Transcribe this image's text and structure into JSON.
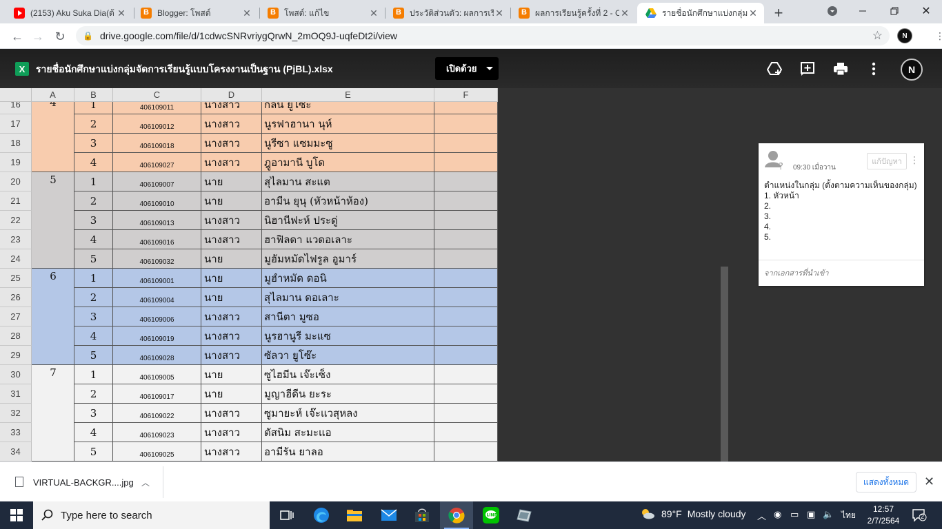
{
  "browser": {
    "tabs": [
      {
        "title": "(2153) Aku Suka Dia(ต้",
        "icon": "youtube-icon",
        "active": false
      },
      {
        "title": "Blogger: โพสต์",
        "icon": "blogger-icon",
        "active": false
      },
      {
        "title": "โพสต์: แก้ไข",
        "icon": "blogger-icon",
        "active": false
      },
      {
        "title": "ประวัติส่วนตัว: ผลการเรียนรู้",
        "icon": "blogger-icon",
        "active": false
      },
      {
        "title": "ผลการเรียนรู้ครั้งที่ 2 - CC",
        "icon": "blogger-icon",
        "active": false
      },
      {
        "title": "รายชื่อนักศึกษาแบ่งกลุ่มจัด",
        "icon": "google-drive-icon",
        "active": true
      }
    ],
    "new_tab": "+",
    "url": "drive.google.com/file/d/1cdwcSNRvriygQrwN_2mOQ9J-uqfeDt2i/view",
    "profile_initial": "N"
  },
  "viewer": {
    "file_icon": "X",
    "file_title": "รายชื่อนักศึกษาแบ่งกลุ่มจัดการเรียนรู้แบบโครงงานเป็นฐาน (PjBL).xlsx",
    "open_with_label": "เปิดด้วย",
    "profile_initial": "N"
  },
  "sheet": {
    "columns": [
      "A",
      "B",
      "C",
      "D",
      "E",
      "F"
    ],
    "groups": [
      {
        "number": "4",
        "color": "#f8ccae",
        "rows": [
          {
            "row": "16",
            "b": "1",
            "c": "406109011",
            "d": "นางสาว",
            "e": "กลีน ยูโซะ"
          },
          {
            "row": "17",
            "b": "2",
            "c": "406109012",
            "d": "นางสาว",
            "e": "นูรฟาฮานา นุห์"
          },
          {
            "row": "18",
            "b": "3",
            "c": "406109018",
            "d": "นางสาว",
            "e": "นูรีซา แซมมะซู"
          },
          {
            "row": "19",
            "b": "4",
            "c": "406109027",
            "d": "นางสาว",
            "e": "ฎูอามานี บูโด"
          }
        ]
      },
      {
        "number": "5",
        "color": "#d0cece",
        "rows": [
          {
            "row": "20",
            "b": "1",
            "c": "406109007",
            "d": "นาย",
            "e": "สุไลมาน สะแต"
          },
          {
            "row": "21",
            "b": "2",
            "c": "406109010",
            "d": "นาย",
            "e": "อามีน ยุนุ (หัวหน้าห้อง)"
          },
          {
            "row": "22",
            "b": "3",
            "c": "406109013",
            "d": "นางสาว",
            "e": "นิฮานีฟะห์ ประดู่"
          },
          {
            "row": "23",
            "b": "4",
            "c": "406109016",
            "d": "นางสาว",
            "e": "ฮาฟิลดา แวดอเลาะ"
          },
          {
            "row": "24",
            "b": "5",
            "c": "406109032",
            "d": "นาย",
            "e": "มูฮัมหมัดไฟรูล อูมาร์"
          }
        ]
      },
      {
        "number": "6",
        "color": "#b4c7e7",
        "rows": [
          {
            "row": "25",
            "b": "1",
            "c": "406109001",
            "d": "นาย",
            "e": "มูฮำหมัด ดอนิ"
          },
          {
            "row": "26",
            "b": "2",
            "c": "406109004",
            "d": "นาย",
            "e": "สุไลมาน ดอเลาะ"
          },
          {
            "row": "27",
            "b": "3",
            "c": "406109006",
            "d": "นางสาว",
            "e": "สานีตา มูซอ"
          },
          {
            "row": "28",
            "b": "4",
            "c": "406109019",
            "d": "นางสาว",
            "e": "นูรฮานูรี มะแซ"
          },
          {
            "row": "29",
            "b": "5",
            "c": "406109028",
            "d": "นางสาว",
            "e": "ซัลวา ยูโซ๊ะ"
          }
        ]
      },
      {
        "number": "7",
        "color": "#f2f2f2",
        "rows": [
          {
            "row": "30",
            "b": "1",
            "c": "406109005",
            "d": "นาย",
            "e": "ซูไฮมีน เจ๊ะเซ็ง"
          },
          {
            "row": "31",
            "b": "2",
            "c": "406109017",
            "d": "นาย",
            "e": "มูญาฮีดีน ยะระ"
          },
          {
            "row": "32",
            "b": "3",
            "c": "406109022",
            "d": "นางสาว",
            "e": "ซูมายะห์ เจ๊ะแวสุหลง"
          },
          {
            "row": "33",
            "b": "4",
            "c": "406109023",
            "d": "นางสาว",
            "e": "ตัสนิม สะมะแอ"
          },
          {
            "row": "34",
            "b": "5",
            "c": "406109025",
            "d": "นางสาว",
            "e": "อามีรัน ยาลอ"
          }
        ]
      }
    ]
  },
  "comment": {
    "time": "09:30 เมื่อวาน",
    "resolve_label": "แก้ปัญหา",
    "text": "ตำแหน่งในกลุ่ม (ตั้งตามความเห็นของกลุ่ม)\n1. หัวหน้า\n2.\n3.\n4.\n5.",
    "source": "จากเอกสารที่นำเข้า"
  },
  "downloads": {
    "file_name": "VIRTUAL-BACKGR....jpg",
    "show_all_label": "แสดงทั้งหมด"
  },
  "taskbar": {
    "search_placeholder": "Type here to search",
    "weather_temp": "89°F",
    "weather_text": "Mostly cloudy",
    "language": "ไทย",
    "time": "12:57",
    "date": "2/7/2564",
    "notification_count": "2"
  }
}
